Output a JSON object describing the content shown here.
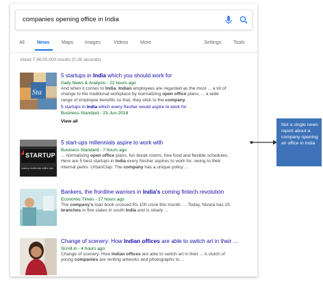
{
  "search": {
    "query": "companies opening office in India",
    "mic_icon": "microphone-icon",
    "search_icon": "magnifier-icon"
  },
  "tabs": [
    "All",
    "News",
    "Maps",
    "Images",
    "Videos",
    "More",
    "Settings",
    "Tools"
  ],
  "active_tab": "News",
  "stats": "About 7,56,00,000 results (0.28 seconds)",
  "results": [
    {
      "title_parts": [
        {
          "t": "5 startups in ",
          "b": false
        },
        {
          "t": "India",
          "b": true
        },
        {
          "t": " which you should work for",
          "b": false
        }
      ],
      "source": "Daily News & Analysis - 22 hours ago",
      "snippet_lines": [
        [
          {
            "t": "And when it comes to ",
            "b": false
          },
          {
            "t": "India",
            "b": true
          },
          {
            "t": ", ",
            "b": false
          },
          {
            "t": "Indian",
            "b": true
          },
          {
            "t": " employees are regarded as the most ... a lot of",
            "b": false
          }
        ],
        [
          {
            "t": "change to the traditional workplace by normalizing ",
            "b": false
          },
          {
            "t": "open office",
            "b": true
          },
          {
            "t": " plans, ... a wide",
            "b": false
          }
        ],
        [
          {
            "t": "range of employee benefits so that, they stick to the ",
            "b": false
          },
          {
            "t": "company",
            "b": true
          },
          {
            "t": ".",
            "b": false
          }
        ]
      ],
      "sub_title_parts": [
        {
          "t": "5 startups in ",
          "b": false
        },
        {
          "t": "India",
          "b": true
        },
        {
          "t": " which every fresher would aspire to work for",
          "b": false
        }
      ],
      "sub_source": "Business Standard - 23-Jun-2018",
      "view_all": "View all",
      "thumb": "startup-collage-thumbnail"
    },
    {
      "title": "5 start-ups millennials aspire to work with",
      "source": "Business Standard - 7 hours ago",
      "snippet_lines": [
        [
          {
            "t": "... normalising ",
            "b": false
          },
          {
            "t": "open office",
            "b": true
          },
          {
            "t": " plans, fun break rooms, free food and flexible schedules.",
            "b": false
          }
        ],
        [
          {
            "t": "Here are 5 best startups in ",
            "b": false
          },
          {
            "t": "India",
            "b": true
          },
          {
            "t": " every fresher aspires to work for, owing to their",
            "b": false
          }
        ],
        [
          {
            "t": "internal perks: UrbanClap: The ",
            "b": false
          },
          {
            "t": "company",
            "b": true
          },
          {
            "t": " has a unique policy ...",
            "b": false
          }
        ]
      ],
      "thumb": "startup-sign-thumbnail",
      "thumb_caption_top": "STARTUP",
      "thumb_caption_bottom": "#startup #millenials #office #job"
    },
    {
      "title_parts": [
        {
          "t": "Bankers, the frontline warriors in ",
          "b": false
        },
        {
          "t": "India's",
          "b": true
        },
        {
          "t": " coming fintech revolution",
          "b": false
        }
      ],
      "source": "Economic Times - 17 hours ago",
      "snippet_lines": [
        [
          {
            "t": "The ",
            "b": false
          },
          {
            "t": "company's",
            "b": true
          },
          {
            "t": " loan book crossed Rs 100 crore this month. ... Today, Nivara has 25",
            "b": false
          }
        ],
        [
          {
            "t": "branches",
            "b": true
          },
          {
            "t": " in five states in south ",
            "b": false
          },
          {
            "t": "India",
            "b": true
          },
          {
            "t": " and is slowly ...",
            "b": false
          }
        ]
      ],
      "thumb": "banker-photo-thumbnail"
    },
    {
      "title_parts": [
        {
          "t": "Change of scenery: How ",
          "b": false
        },
        {
          "t": "Indian offices",
          "b": true
        },
        {
          "t": " are able to switch art in their ...",
          "b": false
        }
      ],
      "source": "Scroll.in - 4 hours ago",
      "snippet_lines": [
        [
          {
            "t": "Change of scenery: How ",
            "b": false
          },
          {
            "t": "Indian offices",
            "b": true
          },
          {
            "t": " are able to switch art in their ... A clutch of",
            "b": false
          }
        ],
        [
          {
            "t": "young ",
            "b": false
          },
          {
            "t": "companies",
            "b": true
          },
          {
            "t": " are renting artworks and photographs to ...",
            "b": false
          }
        ]
      ],
      "thumb": "woman-portrait-thumbnail"
    }
  ],
  "callout": {
    "text": "Not a single news report about a company opening an office in India",
    "arrow_icon": "double-headed-arrow-icon"
  },
  "colors": {
    "link": "#1a0dab",
    "source_green": "#006621",
    "tab_active": "#1a73e8",
    "callout_bg": "#3e73b9"
  }
}
